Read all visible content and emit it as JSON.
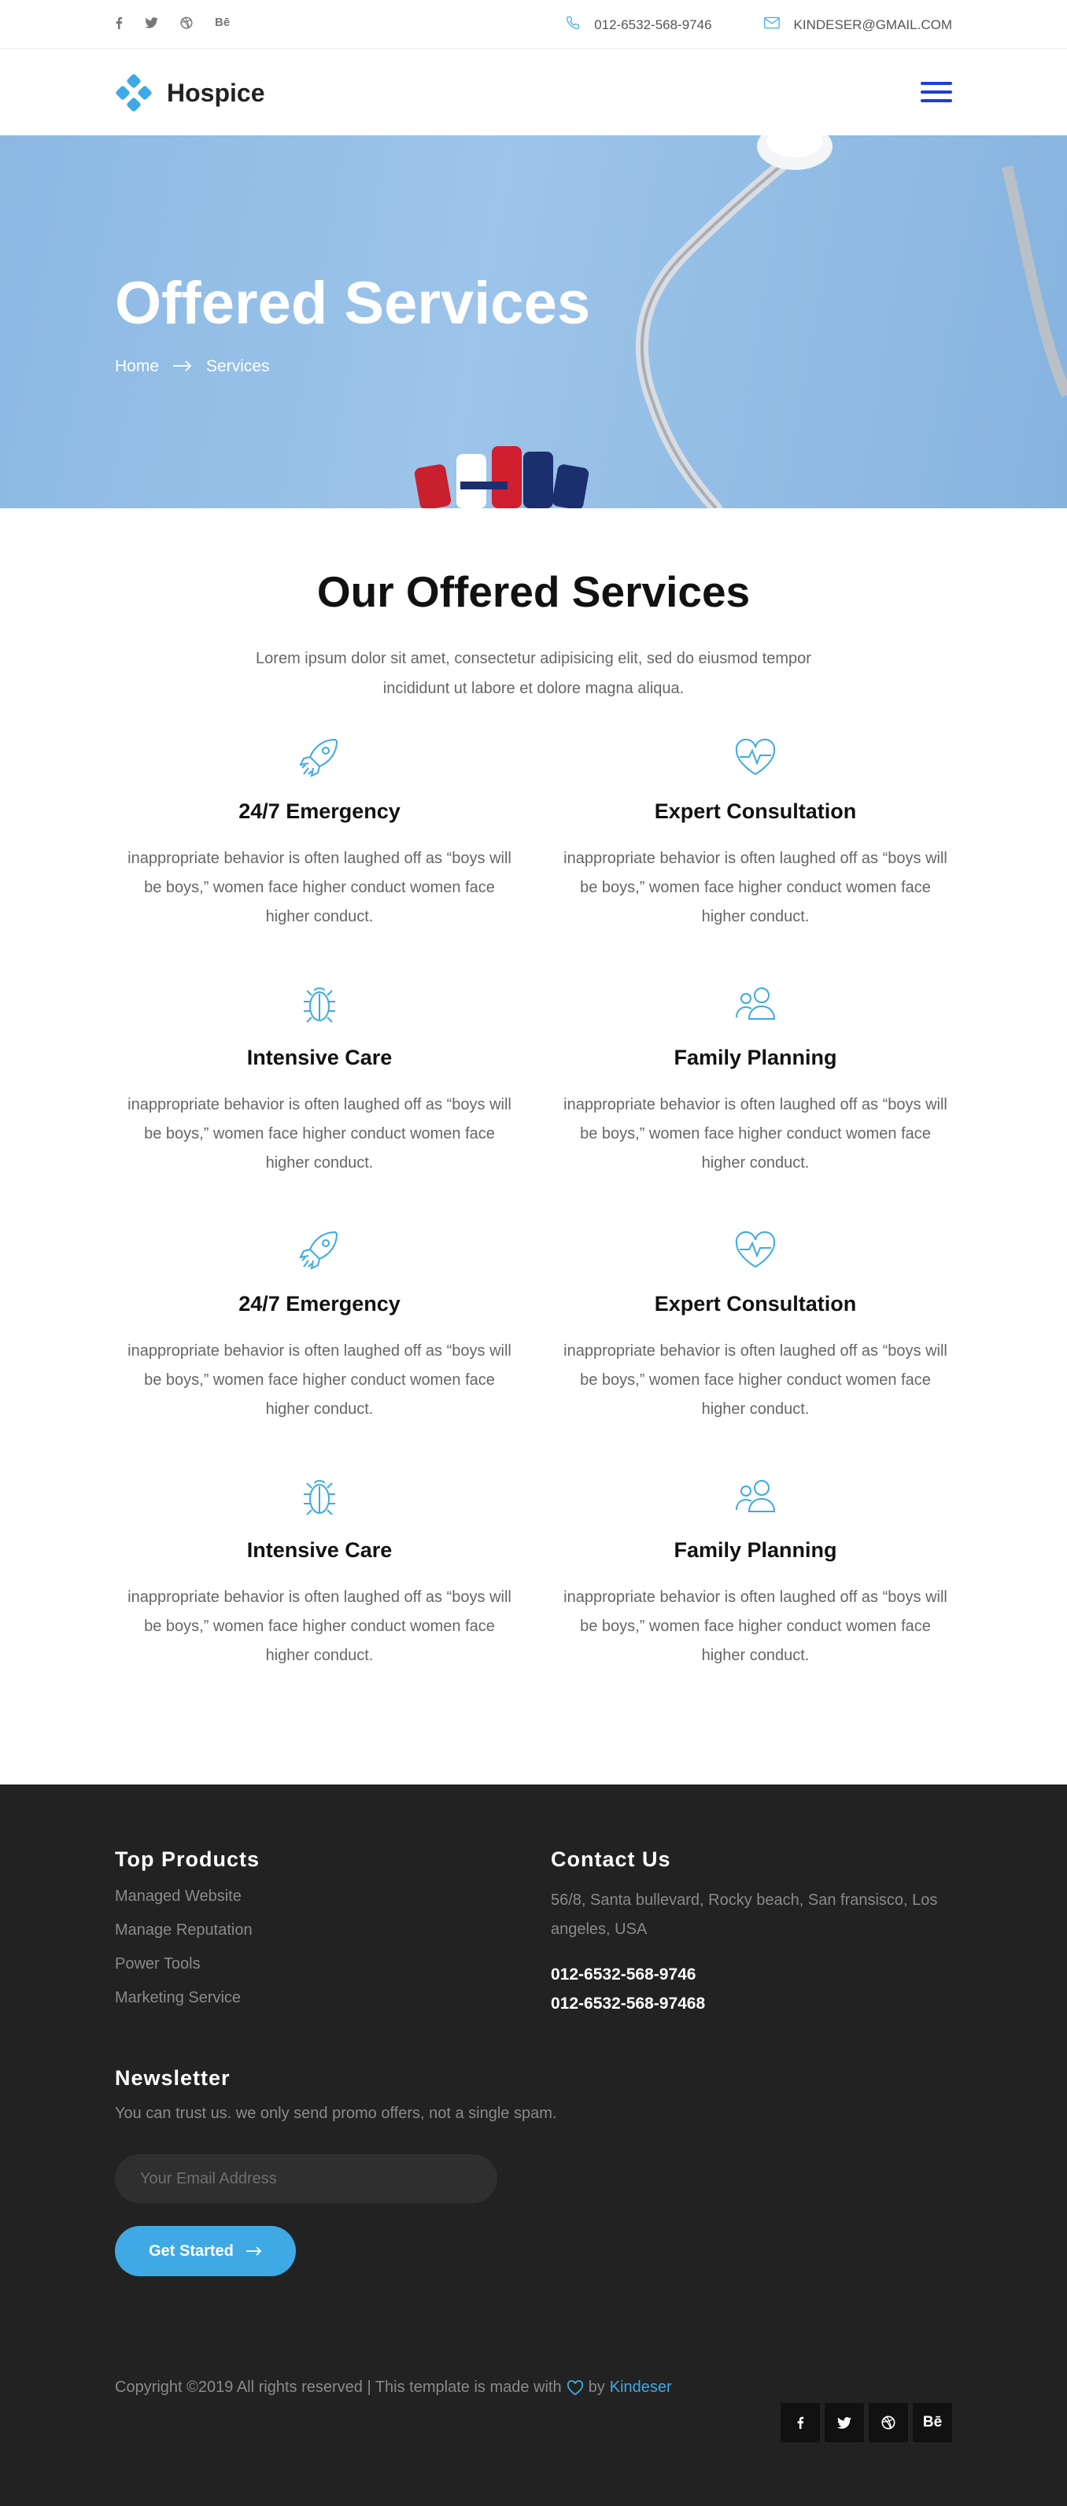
{
  "topbar": {
    "social": [
      {
        "icon": "facebook-icon",
        "glyph": "f"
      },
      {
        "icon": "twitter-icon",
        "glyph": "t"
      },
      {
        "icon": "dribbble-icon",
        "glyph": "◎"
      },
      {
        "icon": "behance-icon",
        "glyph": "Bē"
      }
    ],
    "phone": "012-6532-568-9746",
    "email": "KINDESER@GMAIL.COM"
  },
  "nav": {
    "logo_text": "Hospice"
  },
  "banner": {
    "title": "Offered Services",
    "breadcrumb_home": "Home",
    "breadcrumb_current": "Services"
  },
  "services": {
    "title": "Our Offered Services",
    "subtitle": "Lorem ipsum dolor sit amet, consectetur adipisicing elit, sed do eiusmod tempor incididunt ut labore et dolore magna aliqua.",
    "items": [
      {
        "icon": "rocket-icon",
        "title": "24/7 Emergency",
        "desc": "inappropriate behavior is often laughed off as “boys will be boys,” women face higher conduct women face higher conduct."
      },
      {
        "icon": "heartbeat-icon",
        "title": "Expert Consultation",
        "desc": "inappropriate behavior is often laughed off as “boys will be boys,” women face higher conduct women face higher conduct."
      },
      {
        "icon": "bug-icon",
        "title": "Intensive Care",
        "desc": "inappropriate behavior is often laughed off as “boys will be boys,” women face higher conduct women face higher conduct."
      },
      {
        "icon": "family-icon",
        "title": "Family Planning",
        "desc": "inappropriate behavior is often laughed off as “boys will be boys,” women face higher conduct women face higher conduct."
      },
      {
        "icon": "rocket-icon",
        "title": "24/7 Emergency",
        "desc": "inappropriate behavior is often laughed off as “boys will be boys,” women face higher conduct women face higher conduct."
      },
      {
        "icon": "heartbeat-icon",
        "title": "Expert Consultation",
        "desc": "inappropriate behavior is often laughed off as “boys will be boys,” women face higher conduct women face higher conduct."
      },
      {
        "icon": "bug-icon",
        "title": "Intensive Care",
        "desc": "inappropriate behavior is often laughed off as “boys will be boys,” women face higher conduct women face higher conduct."
      },
      {
        "icon": "family-icon",
        "title": "Family Planning",
        "desc": "inappropriate behavior is often laughed off as “boys will be boys,” women face higher conduct women face higher conduct."
      }
    ]
  },
  "footer": {
    "products_title": "Top Products",
    "products": [
      "Managed Website",
      "Manage Reputation",
      "Power Tools",
      "Marketing Service"
    ],
    "contact_title": "Contact Us",
    "address": "56/8, Santa bullevard, Rocky beach, San fransisco, Los angeles, USA",
    "phone1": "012-6532-568-9746",
    "phone2": "012-6532-568-97468",
    "newsletter_title": "Newsletter",
    "newsletter_text": "You can trust us. we only send promo offers, not a single spam.",
    "email_placeholder": "Your Email Address",
    "cta_label": "Get Started",
    "copyright_prefix": "Copyright ©2019 All rights reserved | This template is made with",
    "copyright_by": "by",
    "copyright_brand": "Kindeser",
    "social": [
      {
        "icon": "facebook-icon",
        "glyph": "f"
      },
      {
        "icon": "twitter-icon",
        "glyph": "t"
      },
      {
        "icon": "dribbble-icon",
        "glyph": "◎"
      },
      {
        "icon": "behance-icon",
        "glyph": "Bē"
      }
    ]
  },
  "colors": {
    "accent": "#3ea9e4",
    "nav_icon": "#1d3fd6",
    "footer_bg": "#222222",
    "banner_bg": "#9dc4ea"
  }
}
